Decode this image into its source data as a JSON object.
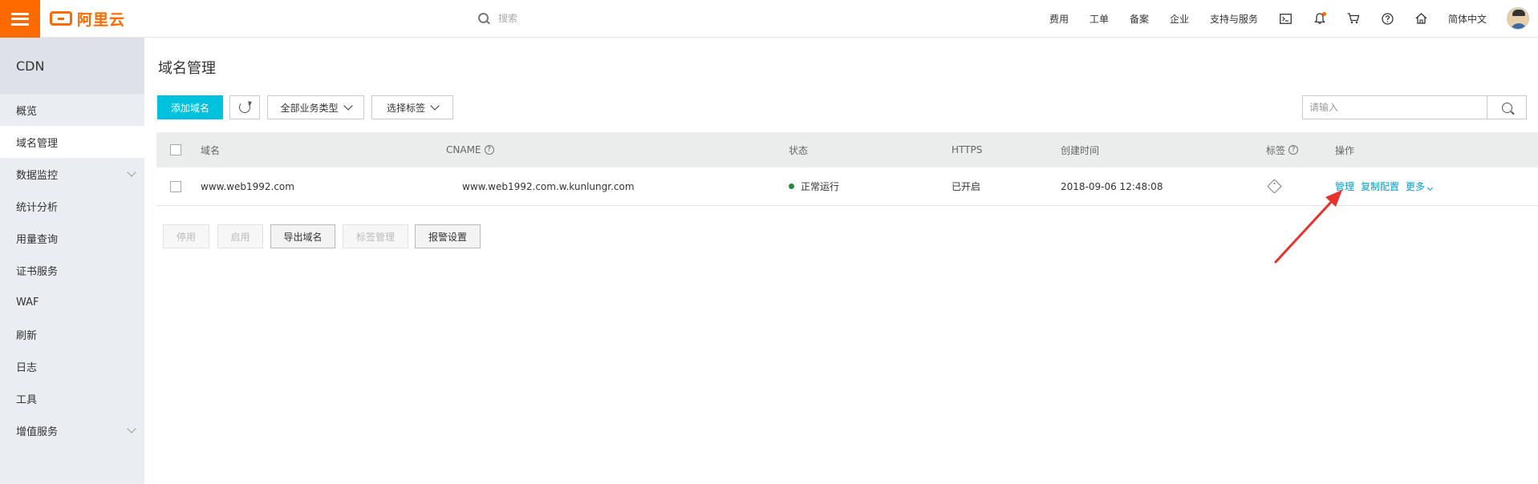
{
  "topbar": {
    "logo_text": "阿里云",
    "search_placeholder": "搜索",
    "links": [
      "费用",
      "工单",
      "备案",
      "企业",
      "支持与服务"
    ],
    "language": "简体中文"
  },
  "sidebar": {
    "title": "CDN",
    "items": [
      {
        "label": "概览"
      },
      {
        "label": "域名管理"
      },
      {
        "label": "数据监控"
      },
      {
        "label": "统计分析"
      },
      {
        "label": "用量查询"
      },
      {
        "label": "证书服务"
      },
      {
        "label": "WAF"
      },
      {
        "label": "刷新"
      },
      {
        "label": "日志"
      },
      {
        "label": "工具"
      },
      {
        "label": "增值服务"
      }
    ]
  },
  "main": {
    "title": "域名管理",
    "toolbar": {
      "add_label": "添加域名",
      "filter_type_label": "全部业务类型",
      "filter_tag_label": "选择标签",
      "search_placeholder": "请输入"
    },
    "table": {
      "headers": {
        "domain": "域名",
        "cname": "CNAME",
        "status": "状态",
        "https": "HTTPS",
        "created": "创建时间",
        "tag": "标签",
        "ops": "操作"
      },
      "rows": [
        {
          "domain": "www.web1992.com",
          "cname": "www.web1992.com.w.kunlungr.com",
          "status": "正常运行",
          "https": "已开启",
          "created": "2018-09-06 12:48:08",
          "op_manage": "管理",
          "op_copy": "复制配置",
          "op_more": "更多"
        }
      ]
    },
    "bulk": {
      "stop": "停用",
      "start": "启用",
      "export": "导出域名",
      "tag_manage": "标签管理",
      "alarm": "报警设置"
    }
  },
  "colors": {
    "brand": "#ff6a00",
    "primary": "#00c1de",
    "link": "#00a2ca",
    "annotation_arrow": "#e8312c"
  }
}
